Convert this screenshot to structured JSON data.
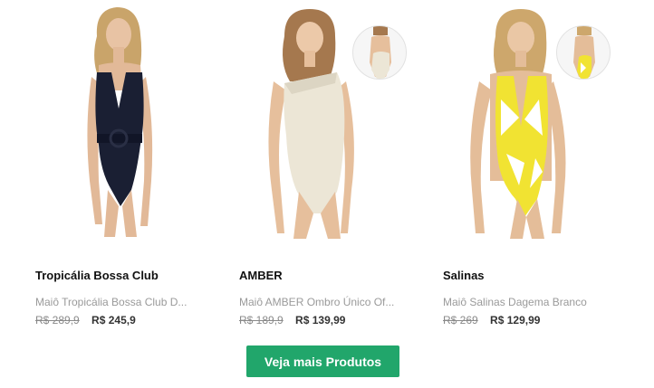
{
  "products": [
    {
      "name": "Tropicália Bossa Club",
      "description": "Maiô Tropicália Bossa Club D...",
      "old_price": "R$ 289,9",
      "price": "R$ 245,9",
      "image_icon": "model-black-swimsuit-image"
    },
    {
      "name": "AMBER",
      "description": "Maiô AMBER Ombro Único Of...",
      "old_price": "R$ 189,9",
      "price": "R$ 139,99",
      "image_icon": "model-cream-one-shoulder-swimsuit-image"
    },
    {
      "name": "Salinas",
      "description": "Maiô Salinas Dagema Branco",
      "old_price": "R$ 269",
      "price": "R$ 129,99",
      "image_icon": "model-yellow-print-swimsuit-image"
    }
  ],
  "more_button": {
    "label": "Veja mais Produtos"
  },
  "colors": {
    "button": "#21a66b",
    "price_old": "#8a8a8a",
    "price_new": "#333333",
    "description": "#9a9a9a"
  }
}
